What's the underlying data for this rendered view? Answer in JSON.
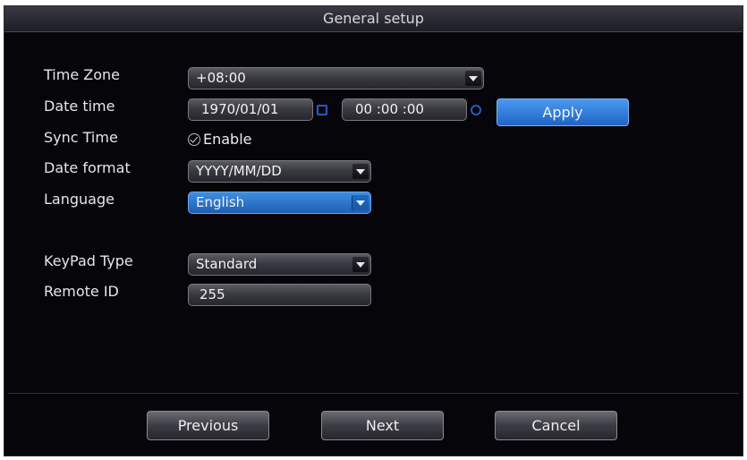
{
  "dialog": {
    "title": "General setup"
  },
  "time_zone": {
    "label": "Time Zone",
    "value": "+08:00"
  },
  "date_time": {
    "label": "Date time",
    "date": "1970/01/01",
    "time": "00 :00 :00",
    "apply_label": "Apply"
  },
  "sync_time": {
    "label": "Sync Time",
    "option": "Enable",
    "checked": true
  },
  "date_format": {
    "label": "Date format",
    "value": "YYYY/MM/DD"
  },
  "language": {
    "label": "Language",
    "value": "English"
  },
  "keypad_type": {
    "label": "KeyPad Type",
    "value": "Standard"
  },
  "remote_id": {
    "label": "Remote ID",
    "value": "255"
  },
  "footer": {
    "previous_label": "Previous",
    "next_label": "Next",
    "cancel_label": "Cancel"
  }
}
